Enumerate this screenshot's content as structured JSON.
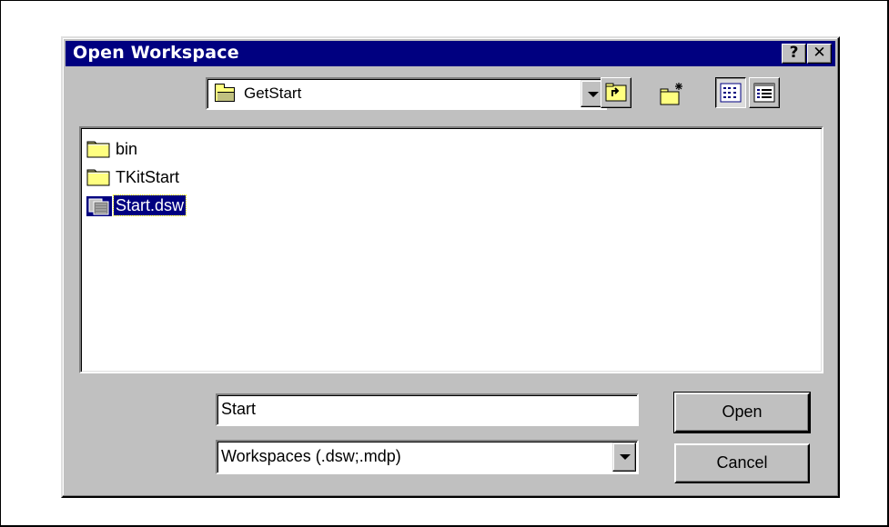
{
  "dialog": {
    "title": "Open Workspace",
    "help_button": "?",
    "close_button": "✕"
  },
  "look_in": {
    "value": "GetStart",
    "icon": "folder-open-icon"
  },
  "toolbar": {
    "buttons": [
      {
        "name": "up-one-level",
        "icon": "folder-up-icon"
      },
      {
        "name": "create-new-folder",
        "icon": "new-folder-icon"
      },
      {
        "name": "list-view",
        "icon": "list-view-icon",
        "pressed": true
      },
      {
        "name": "details-view",
        "icon": "details-view-icon",
        "pressed": false
      }
    ]
  },
  "files": [
    {
      "name": "bin",
      "type": "folder",
      "selected": false
    },
    {
      "name": "TKitStart",
      "type": "folder",
      "selected": false
    },
    {
      "name": "Start.dsw",
      "type": "workspace",
      "selected": true
    }
  ],
  "file_name": {
    "value": "Start"
  },
  "file_type": {
    "value": "Workspaces (.dsw;.mdp)"
  },
  "buttons": {
    "open": "Open",
    "cancel": "Cancel"
  },
  "colors": {
    "titlebar": "#000080",
    "dialog_face": "#c0c0c0",
    "selection": "#000080",
    "folder": "#ffff80"
  }
}
